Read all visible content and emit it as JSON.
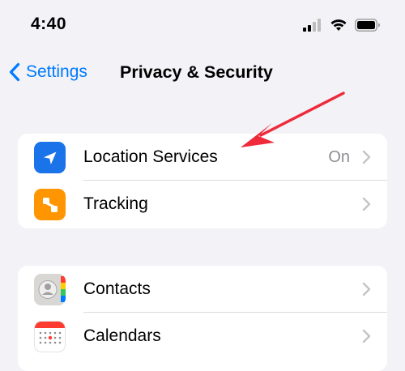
{
  "status_bar": {
    "time": "4:40"
  },
  "nav": {
    "back_label": "Settings",
    "title": "Privacy & Security"
  },
  "sections": [
    {
      "rows": [
        {
          "label": "Location Services",
          "value": "On",
          "icon": "location-arrow-icon",
          "icon_color": "#1a73e8"
        },
        {
          "label": "Tracking",
          "value": "",
          "icon": "tracking-icon",
          "icon_color": "#ff9500"
        }
      ]
    },
    {
      "rows": [
        {
          "label": "Contacts",
          "value": "",
          "icon": "contacts-icon",
          "icon_color": "#d9d9d9"
        },
        {
          "label": "Calendars",
          "value": "",
          "icon": "calendar-icon",
          "icon_color": "#ffffff"
        }
      ]
    }
  ],
  "colors": {
    "accent": "#007aff",
    "background": "#f2f2f7",
    "annotation_arrow": "#ee2a3b"
  }
}
